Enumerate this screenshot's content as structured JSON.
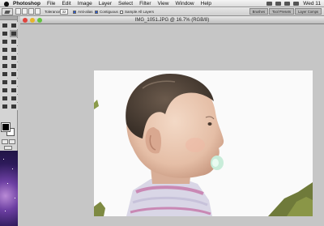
{
  "menubar": {
    "menus": [
      "Photoshop",
      "File",
      "Edit",
      "Image",
      "Layer",
      "Select",
      "Filter",
      "View",
      "Window",
      "Help"
    ],
    "clock": "Wed 11"
  },
  "options_bar": {
    "tolerance_label": "Tolerance:",
    "tolerance_value": "32",
    "anti_alias_label": "Anti-alias",
    "contiguous_label": "Contiguous",
    "sample_all_label": "Sample All Layers",
    "panel_tabs": [
      "Brushes",
      "Tool Presets",
      "Layer Comps"
    ]
  },
  "tools": {
    "names": [
      "move-tool",
      "marquee-tool",
      "lasso-tool",
      "magic-wand-tool",
      "crop-tool",
      "slice-tool",
      "healing-tool",
      "brush-tool",
      "clone-stamp-tool",
      "history-brush-tool",
      "eraser-tool",
      "gradient-tool",
      "blur-tool",
      "dodge-tool",
      "path-selection-tool",
      "type-tool",
      "pen-tool",
      "shape-tool",
      "notes-tool",
      "eyedropper-tool",
      "hand-tool",
      "zoom-tool"
    ],
    "selected_index": 3
  },
  "document": {
    "title": "IMG_1051.JPG @ 16.7% (RGB/8)"
  },
  "colors": {
    "foreground": "#000000",
    "background": "#ffffff",
    "workspace": "#c6c6c6"
  }
}
